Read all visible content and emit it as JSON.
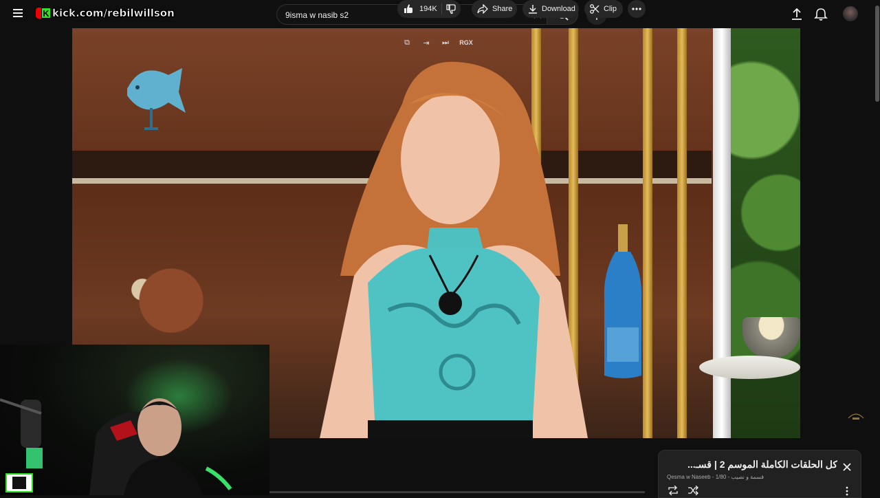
{
  "header": {
    "banner_text": "kick.com/rebilwillson",
    "search_value": "9isma w nasib s2",
    "icons": [
      "menu-icon",
      "close-icon",
      "search-icon",
      "microphone-icon",
      "upload-icon",
      "bell-icon"
    ]
  },
  "player": {
    "overlay_label": "RGX",
    "overlay_icons": [
      "popout-icon",
      "enter-icon",
      "skip-icon"
    ]
  },
  "actions": {
    "like_count": "194K",
    "share_label": "Share",
    "download_label": "Download",
    "clip_label": "Clip"
  },
  "playlist": {
    "title": "كل الحلقات الكاملة الموسم 2 | قسـ...",
    "channel": "Qesma w Naseeb - قسمة و نصيب",
    "position": "1/80"
  },
  "colors": {
    "background": "#0f0f0f",
    "pill": "#272727",
    "kick_green": "#2ee31f"
  }
}
